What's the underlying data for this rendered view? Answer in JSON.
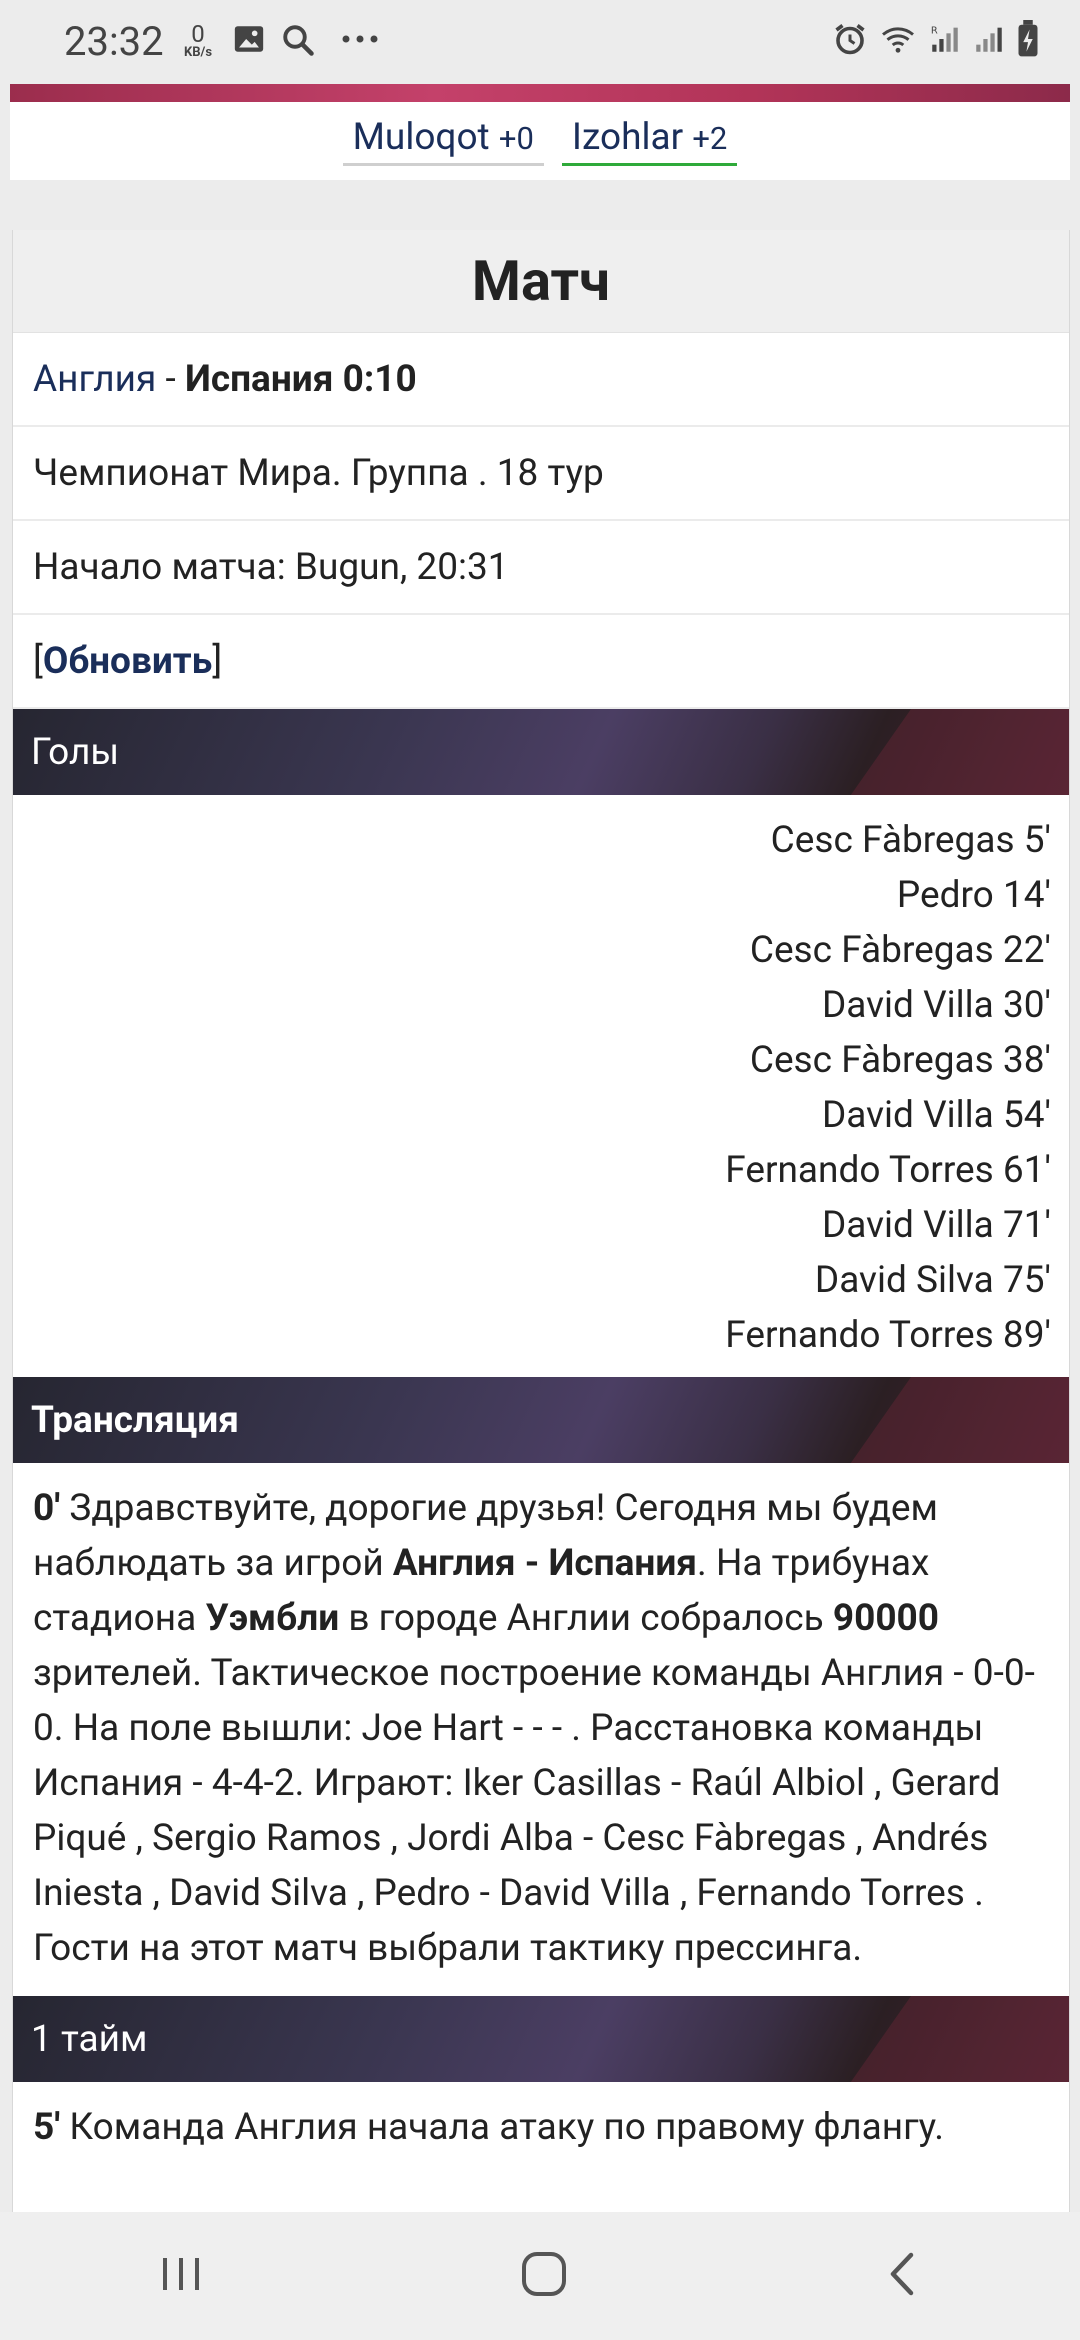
{
  "status_bar": {
    "time": "23:32",
    "net_speed_value": "0",
    "net_speed_unit": "KB/s",
    "icons": [
      "image-icon",
      "search-icon",
      "more-icon",
      "alarm-icon",
      "wifi-icon",
      "signal-icon",
      "signal-icon",
      "battery-charging-icon"
    ]
  },
  "menu": {
    "items": [
      {
        "label": "Muloqot",
        "count": "+0"
      },
      {
        "label": "Izohlar",
        "count": "+2"
      }
    ]
  },
  "match": {
    "title": "Матч",
    "home_team": "Англия",
    "separator": " - ",
    "away_team_score": "Испания 0:10",
    "tournament": "Чемпионат Мира. Группа . 18 тур",
    "start": "Начало матча: Bugun, 20:31",
    "refresh_label": "Обновить"
  },
  "goals": {
    "heading": "Голы",
    "items": [
      "Cesc Fàbregas 5'",
      "Pedro 14'",
      "Cesc Fàbregas 22'",
      "David Villa 30'",
      "Cesc Fàbregas 38'",
      "David Villa 54'",
      "Fernando Torres 61'",
      "David Villa 71'",
      "David Silva 75'",
      "Fernando Torres 89'"
    ]
  },
  "broadcast": {
    "heading": "Трансляция",
    "minute": "0'",
    "p1": " Здравствуйте, дорогие друзья! Сегодня мы будем наблюдать за игрой ",
    "b1": "Англия - Испания",
    "p2": ". На трибунах стадиона ",
    "b2": "Уэмбли",
    "p3": " в городе Англии собралось ",
    "b3": "90000",
    "p4": " зрителей. Тактическое построение команды Англия - 0-0-0. На поле вышли: Joe Hart - - - . Расстановка команды Испания - 4-4-2. Играют: Iker Casillas - Raúl Albiol , Gerard Piqué , Sergio Ramos , Jordi Alba - Cesc Fàbregas , Andrés Iniesta , David Silva , Pedro - David Villa , Fernando Torres . Гости на этот матч выбрали тактику прессинга."
  },
  "first_half": {
    "heading": "1 тайм",
    "minute": "5'",
    "text": " Команда Англия начала атаку по правому флангу."
  },
  "nav": {
    "icons": [
      "recent-apps-icon",
      "home-icon",
      "back-icon"
    ]
  }
}
